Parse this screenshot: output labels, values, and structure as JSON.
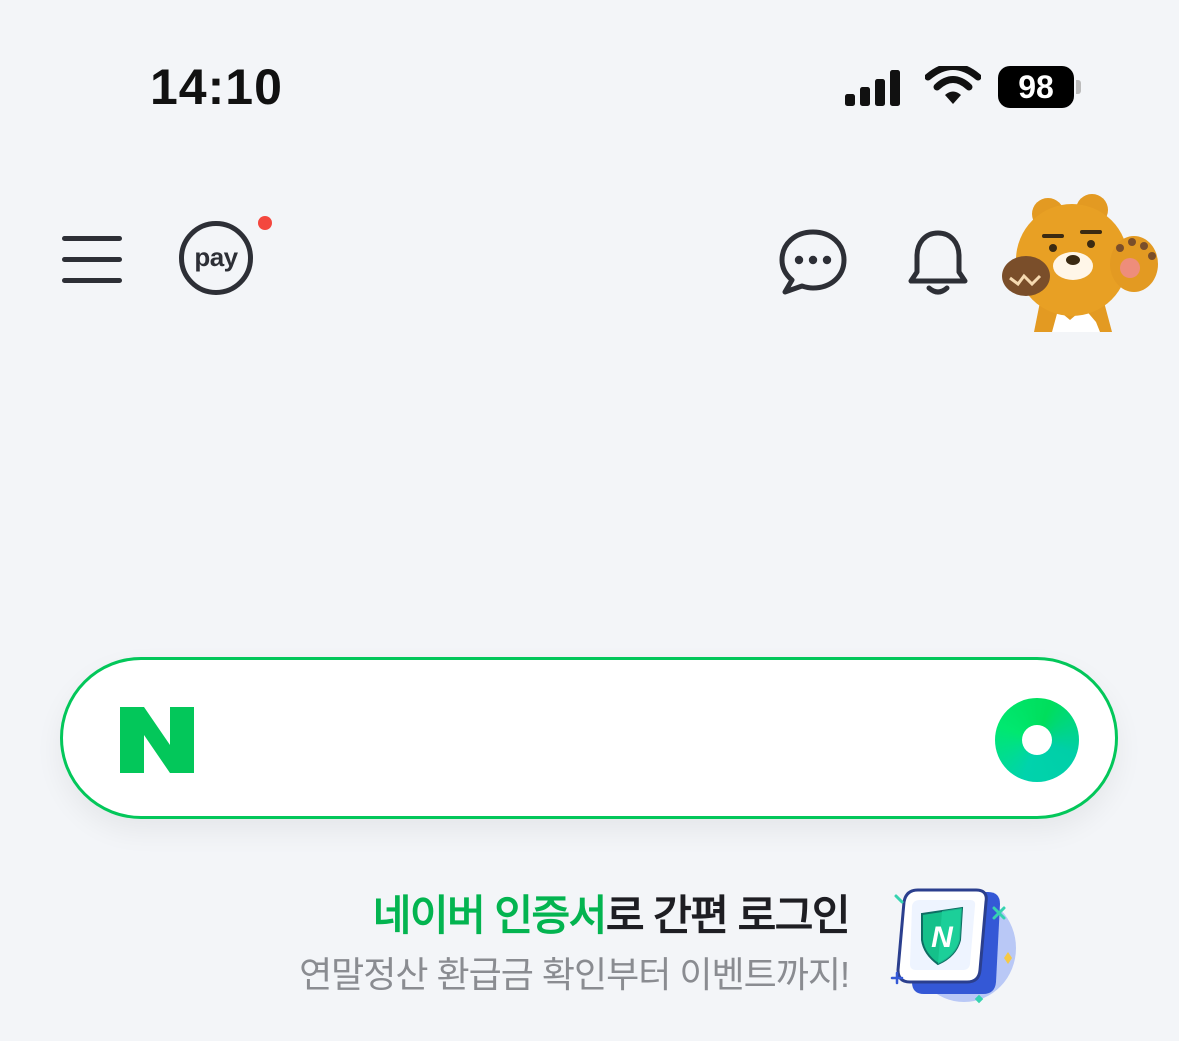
{
  "status_bar": {
    "time": "14:10",
    "battery_level": "98",
    "icons": [
      "cellular-signal-icon",
      "wifi-icon",
      "battery-icon"
    ]
  },
  "top_bar": {
    "menu_icon": "hamburger-menu-icon",
    "pay_label": "pay",
    "pay_has_notification": true,
    "chat_icon": "chat-bubble-icon",
    "bell_icon": "bell-icon",
    "avatar_icon": "bear-character-avatar"
  },
  "search": {
    "logo_letter": "N",
    "placeholder": "",
    "action_icon": "green-dot-icon"
  },
  "promo": {
    "title_highlight": "네이버 인증서",
    "title_rest": "로 간편 로그인",
    "subtitle": "연말정산 환급금 확인부터 이벤트까지!",
    "badge_letter": "N",
    "icon": "certificate-shield-icon"
  },
  "colors": {
    "background": "#f3f5f8",
    "naver_green": "#03c75a",
    "text_dark": "#1e1e23",
    "text_gray": "#8a8c91",
    "notification_red": "#f4473e"
  }
}
